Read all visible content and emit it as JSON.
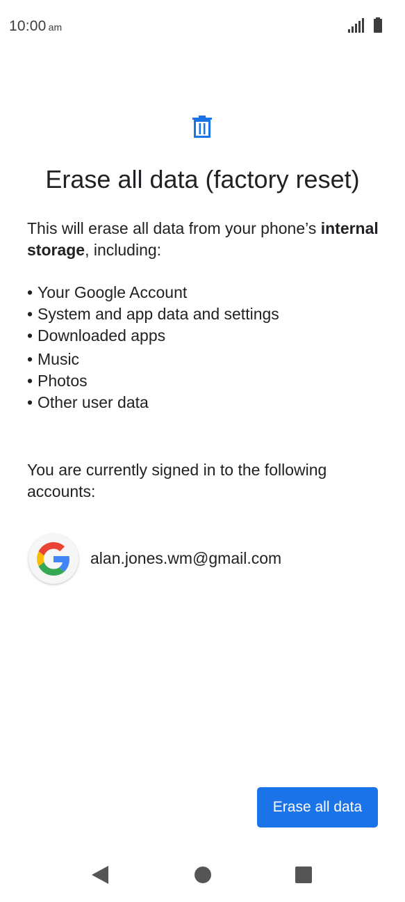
{
  "status_bar": {
    "time": "10:00",
    "ampm": "am",
    "signal_icon": "signal-icon",
    "battery_icon": "battery-icon"
  },
  "header": {
    "icon": "trash-icon",
    "icon_color": "#1a73e8",
    "title": "Erase all data (factory reset)"
  },
  "intro": {
    "text_before": "This will erase all data from your phone’s ",
    "bold": "internal storage",
    "text_after": ", including:"
  },
  "items": [
    "Your Google Account",
    "System and app data and settings",
    "Downloaded apps",
    "Music",
    "Photos",
    "Other user data"
  ],
  "accounts": {
    "label": "You are currently signed in to the following accounts:",
    "list": [
      {
        "icon": "google-g-icon",
        "email": "alan.jones.wm@gmail.com"
      }
    ]
  },
  "actions": {
    "erase_label": "Erase all data",
    "accent": "#1a73e8"
  },
  "nav_bar": {
    "back": "back-icon",
    "home": "home-icon",
    "recents": "recents-icon"
  }
}
